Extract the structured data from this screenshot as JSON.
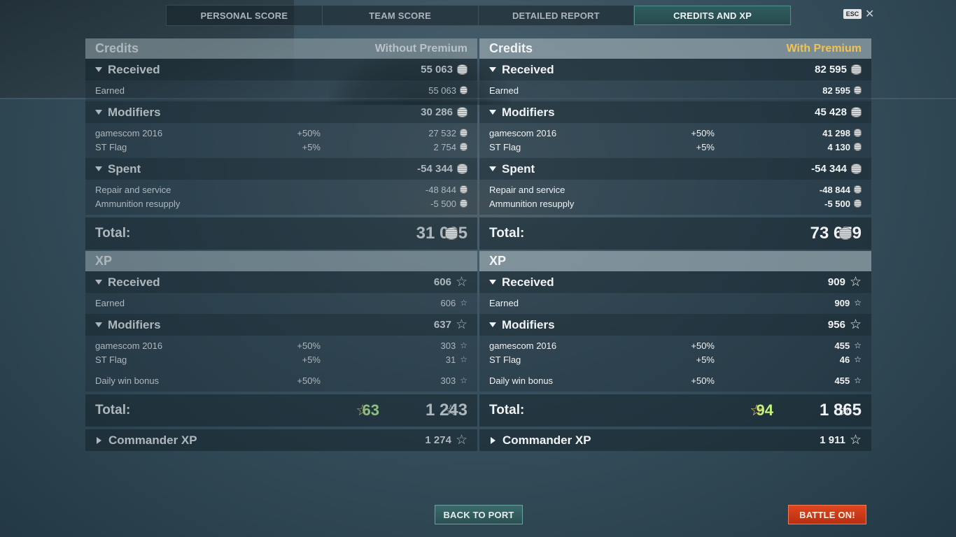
{
  "tabs": [
    {
      "label": "PERSONAL SCORE"
    },
    {
      "label": "TEAM SCORE"
    },
    {
      "label": "DETAILED REPORT"
    },
    {
      "label": "CREDITS AND XP"
    }
  ],
  "esc_label": "ESC",
  "close_glyph": "✕",
  "coin_icon": "silver-coin-icon",
  "xp_icon": "star-icon",
  "star_glyph": "☆",
  "left": {
    "credits": {
      "title": "Credits",
      "subtitle": "Without Premium",
      "received": {
        "label": "Received",
        "value": "55 063"
      },
      "earned": {
        "label": "Earned",
        "value": "55 063"
      },
      "modifiers": {
        "label": "Modifiers",
        "value": "30 286"
      },
      "mod1": {
        "label": "gamescom 2016",
        "pct": "+50%",
        "value": "27 532"
      },
      "mod2": {
        "label": "ST Flag",
        "pct": "+5%",
        "value": "2 754"
      },
      "spent": {
        "label": "Spent",
        "value": "-54 344"
      },
      "spent1": {
        "label": "Repair and service",
        "value": "-48 844"
      },
      "spent2": {
        "label": "Ammunition resupply",
        "value": "-5 500"
      },
      "total": {
        "label": "Total:",
        "value": "31 005"
      }
    },
    "xp": {
      "title": "XP",
      "received": {
        "label": "Received",
        "value": "606"
      },
      "earned": {
        "label": "Earned",
        "value": "606"
      },
      "modifiers": {
        "label": "Modifiers",
        "value": "637"
      },
      "mod1": {
        "label": "gamescom 2016",
        "pct": "+50%",
        "value": "303"
      },
      "mod2": {
        "label": "ST Flag",
        "pct": "+5%",
        "value": "31"
      },
      "mod3": {
        "label": "Daily win bonus",
        "pct": "+50%",
        "value": "303"
      },
      "total": {
        "label": "Total:",
        "bonus": "63",
        "value": "1 243"
      },
      "commander": {
        "label": "Commander XP",
        "value": "1 274"
      }
    }
  },
  "right": {
    "credits": {
      "title": "Credits",
      "subtitle": "With Premium",
      "received": {
        "label": "Received",
        "value": "82 595"
      },
      "earned": {
        "label": "Earned",
        "value": "82 595"
      },
      "modifiers": {
        "label": "Modifiers",
        "value": "45 428"
      },
      "mod1": {
        "label": "gamescom 2016",
        "pct": "+50%",
        "value": "41 298"
      },
      "mod2": {
        "label": "ST Flag",
        "pct": "+5%",
        "value": "4 130"
      },
      "spent": {
        "label": "Spent",
        "value": "-54 344"
      },
      "spent1": {
        "label": "Repair and service",
        "value": "-48 844"
      },
      "spent2": {
        "label": "Ammunition resupply",
        "value": "-5 500"
      },
      "total": {
        "label": "Total:",
        "value": "73 679"
      }
    },
    "xp": {
      "title": "XP",
      "received": {
        "label": "Received",
        "value": "909"
      },
      "earned": {
        "label": "Earned",
        "value": "909"
      },
      "modifiers": {
        "label": "Modifiers",
        "value": "956"
      },
      "mod1": {
        "label": "gamescom 2016",
        "pct": "+50%",
        "value": "455"
      },
      "mod2": {
        "label": "ST Flag",
        "pct": "+5%",
        "value": "46"
      },
      "mod3": {
        "label": "Daily win bonus",
        "pct": "+50%",
        "value": "455"
      },
      "total": {
        "label": "Total:",
        "bonus": "94",
        "value": "1 865"
      },
      "commander": {
        "label": "Commander XP",
        "value": "1 911"
      }
    }
  },
  "buttons": {
    "back_to_port": "BACK TO PORT",
    "battle_on": "BATTLE ON!"
  },
  "colors": {
    "premium_label": "#f5c24b",
    "active_tab": "#2f5d5e",
    "battle_button": "#d03f1a",
    "xp_bonus_green": "#c4f07e"
  }
}
